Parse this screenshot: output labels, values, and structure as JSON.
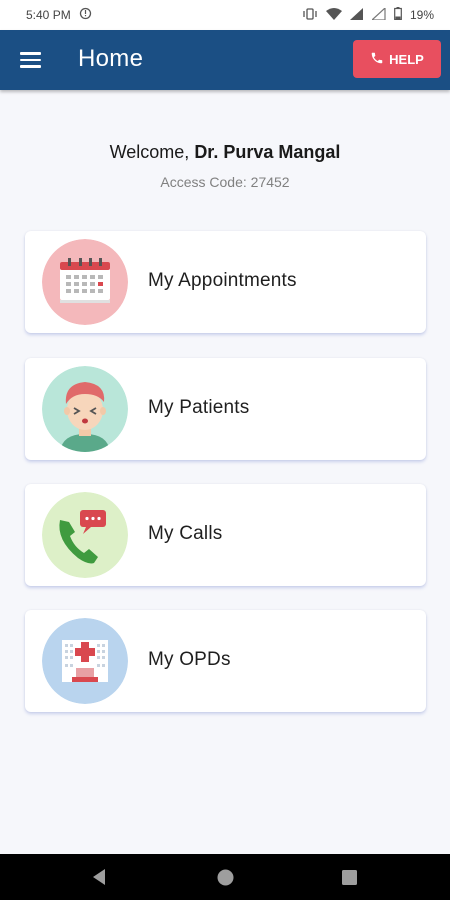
{
  "status_bar": {
    "time": "5:40 PM",
    "battery": "19%"
  },
  "app_bar": {
    "title": "Home",
    "help_label": "HELP"
  },
  "welcome": {
    "prefix": "Welcome, ",
    "name": "Dr. Purva Mangal",
    "access_code": "Access Code: 27452"
  },
  "menu": [
    {
      "label": "My Appointments",
      "icon": "calendar-icon",
      "bg": "#f4b8bb"
    },
    {
      "label": "My Patients",
      "icon": "patient-icon",
      "bg": "#b9e6d9"
    },
    {
      "label": "My Calls",
      "icon": "phone-chat-icon",
      "bg": "#ddf0c8"
    },
    {
      "label": "My OPDs",
      "icon": "hospital-icon",
      "bg": "#b9d4ee"
    }
  ],
  "colors": {
    "app_bar": "#1b4f84",
    "help": "#e84f5f",
    "background": "#f6f7fb"
  }
}
